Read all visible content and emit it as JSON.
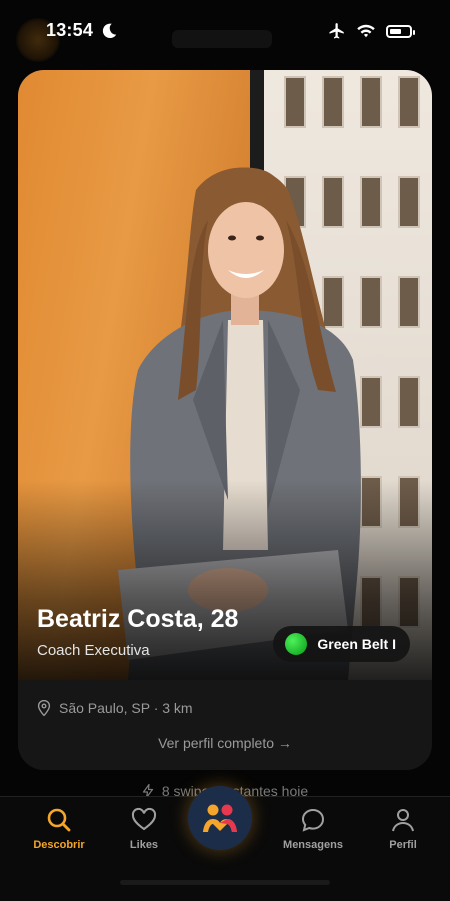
{
  "status_bar": {
    "time": "13:54"
  },
  "profile": {
    "name_age": "Beatriz Costa, 28",
    "job": "Coach Executiva",
    "belt": "Green Belt I",
    "location": "São Paulo, SP · 3 km",
    "view_full_profile": "Ver perfil completo →"
  },
  "swipes_left": "8 swipes restantes hoje",
  "tabs": [
    {
      "label": "Descobrir",
      "icon": "search-icon",
      "active": true
    },
    {
      "label": "Likes",
      "icon": "heart-icon",
      "active": false
    },
    {
      "label": "Mensagens",
      "icon": "chat-icon",
      "active": false
    },
    {
      "label": "Perfil",
      "icon": "user-icon",
      "active": false
    }
  ],
  "colors": {
    "accent": "#f4a52b",
    "belt": "#2ecc40",
    "center_button": "#1c2d4a"
  }
}
